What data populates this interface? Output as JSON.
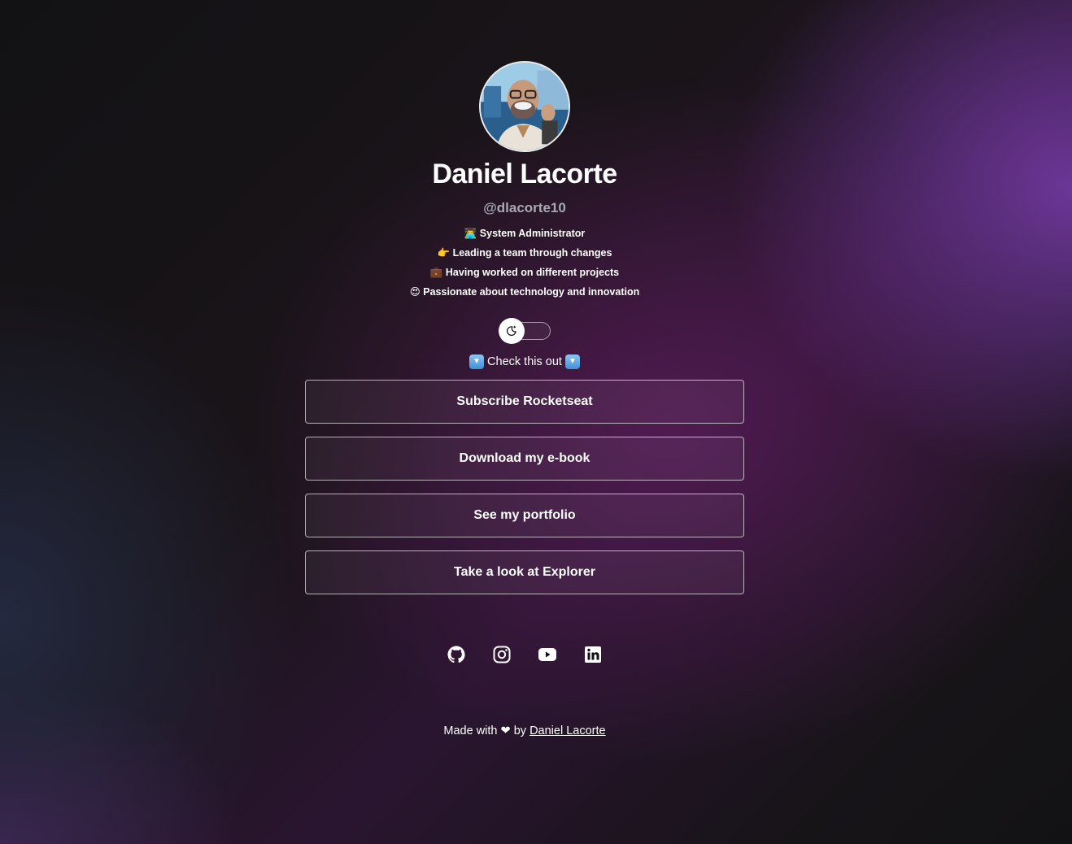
{
  "profile": {
    "name": "Daniel Lacorte",
    "handle": "@dlacorte10",
    "avatar_alt": "Daniel Lacorte avatar"
  },
  "bio": [
    {
      "emoji": "👨‍💻",
      "text": "System Administrator"
    },
    {
      "emoji": "👉",
      "text": "Leading a team through changes"
    },
    {
      "emoji": "💼",
      "text": "Having worked on different projects"
    },
    {
      "emoji": "😍",
      "text": "Passionate about technology and innovation"
    }
  ],
  "theme_toggle": {
    "state": "dark",
    "icon": "moon-sun-icon"
  },
  "check_this_out": {
    "text": "Check this out",
    "icon": "down-arrow-icon"
  },
  "links": [
    {
      "label": "Subscribe Rocketseat"
    },
    {
      "label": "Download my e-book"
    },
    {
      "label": "See my portfolio"
    },
    {
      "label": "Take a look at Explorer"
    }
  ],
  "social": [
    {
      "name": "github-icon"
    },
    {
      "name": "instagram-icon"
    },
    {
      "name": "youtube-icon"
    },
    {
      "name": "linkedin-icon"
    }
  ],
  "footer": {
    "prefix": "Made with",
    "heart": "❤",
    "by": "by",
    "author_link": "Daniel Lacorte"
  },
  "colors": {
    "background": "#121214",
    "accent_purple": "#5a2b8a",
    "text": "#ffffff",
    "muted": "#a8a8b3"
  }
}
